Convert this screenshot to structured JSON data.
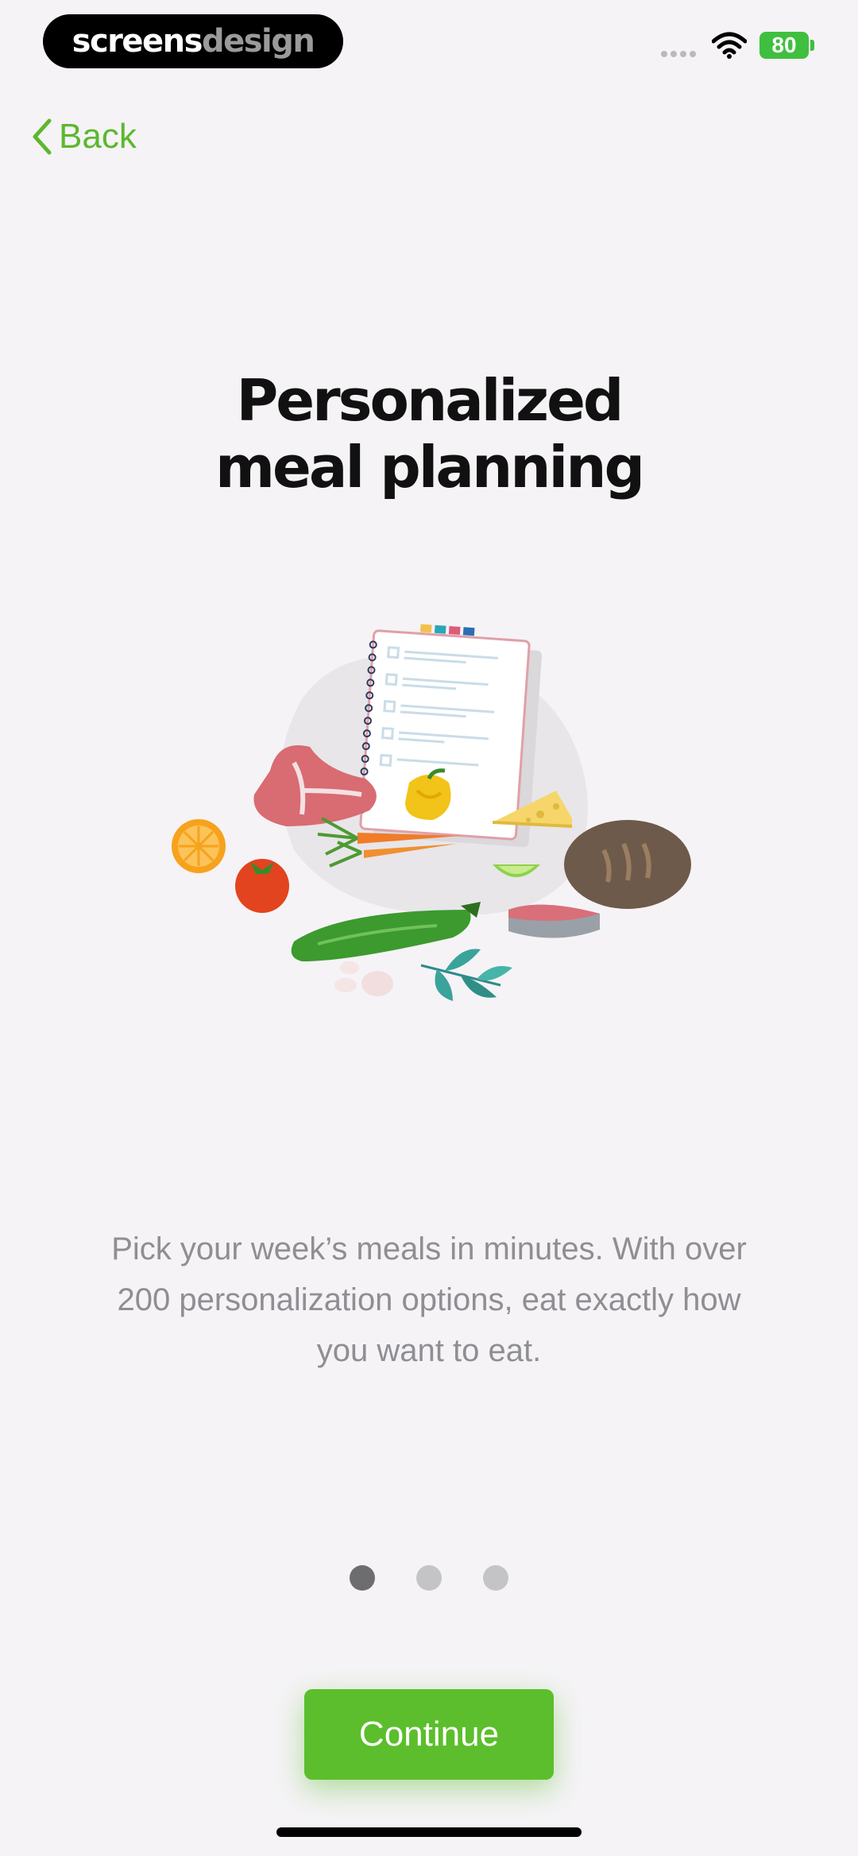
{
  "status_bar": {
    "brand_part1": "screens",
    "brand_part2": "design",
    "battery_level": "80",
    "icons": [
      "signal-dots-icon",
      "wifi-icon",
      "battery-icon"
    ]
  },
  "nav": {
    "back_label": "Back",
    "back_icon": "chevron-left-icon"
  },
  "title": {
    "line1": "Personalized",
    "line2": "meal planning"
  },
  "description": "Pick your week’s meals in minutes. With over 200 personalization options, eat exactly how you want to eat.",
  "pagination": {
    "total": 3,
    "active_index": 0
  },
  "continue_label": "Continue",
  "colors": {
    "accent": "#5cbe2c",
    "background": "#f5f3f6",
    "muted_text": "#8e8e93"
  }
}
